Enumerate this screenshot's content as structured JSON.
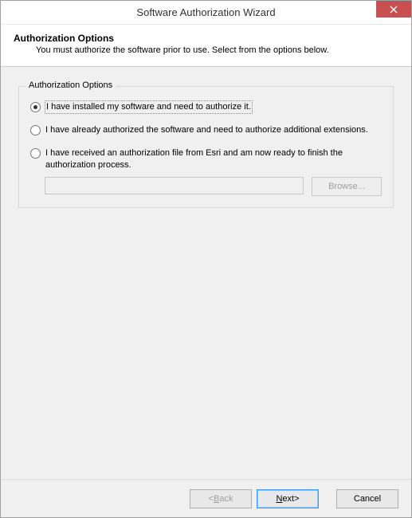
{
  "window": {
    "title": "Software Authorization Wizard"
  },
  "header": {
    "title": "Authorization Options",
    "subtitle": "You must authorize the software prior to use. Select from the options below."
  },
  "group": {
    "legend": "Authorization Options",
    "options": [
      {
        "label": "I have installed my software and need to authorize it.",
        "selected": true
      },
      {
        "label": "I have already authorized the software and need to authorize additional extensions.",
        "selected": false
      },
      {
        "label": "I have received an authorization file from Esri and am now ready to finish the authorization process.",
        "selected": false
      }
    ],
    "browse_label": "Browse...",
    "file_path": ""
  },
  "footer": {
    "back": "< Back",
    "next": "Next >",
    "cancel": "Cancel"
  }
}
